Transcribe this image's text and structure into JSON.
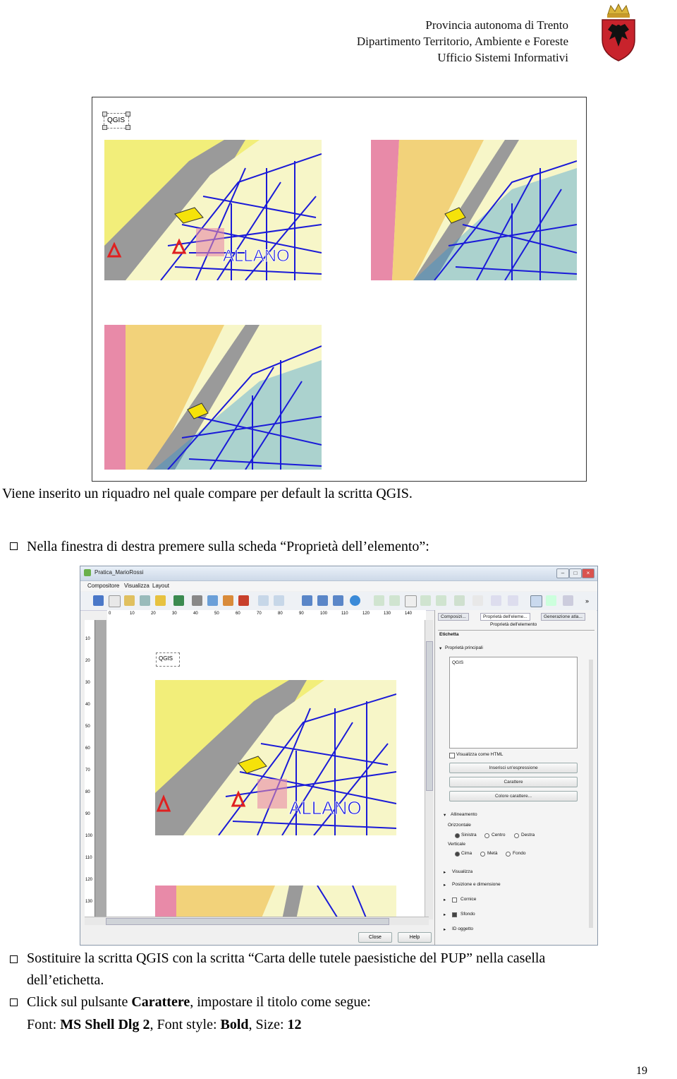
{
  "header": {
    "line1": "Provincia autonoma di Trento",
    "line2": "Dipartimento Territorio, Ambiente e Foreste",
    "line3": "Ufficio Sistemi Informativi"
  },
  "figure1": {
    "qgis_label": "QGIS",
    "map_label": "ALLANO"
  },
  "caption1": "Viene inserito un riquadro nel quale compare per default la scritta QGIS.",
  "bullet1": "Nella finestra di destra premere sulla scheda “Proprietà dell’elemento”:",
  "qgis_window": {
    "title": "Pratica_MarioRossi",
    "menus": [
      "Compositore",
      "Visualizza",
      "Layout"
    ],
    "ruler_top": [
      "0",
      "10",
      "20",
      "30",
      "40",
      "50",
      "60",
      "70",
      "80",
      "90",
      "100",
      "110",
      "120",
      "130",
      "140"
    ],
    "ruler_left": [
      "10",
      "20",
      "30",
      "40",
      "50",
      "60",
      "70",
      "80",
      "90",
      "100",
      "110",
      "120",
      "130"
    ],
    "canvas_label": "QGIS",
    "map_label": "ALLANO",
    "tabs": [
      "Composizi...",
      "Proprietà dell'eleme...",
      "Generazione atla..."
    ],
    "subtab": "Proprietà dell'elemento",
    "section_title": "Etichetta",
    "group_main": "Proprietà principali",
    "textbox_value": "QGIS",
    "html_checkbox": "Visualizza come HTML",
    "btn_expression": "Inserisci un'espressione",
    "btn_font": "Carattere",
    "btn_color": "Colore carattere...",
    "align_group": "Allineamento",
    "horizontal": "Orizzontale",
    "h_options": [
      "Sinistra",
      "Centro",
      "Destra"
    ],
    "vertical": "Verticale",
    "v_options": [
      "Cima",
      "Metà",
      "Fondo"
    ],
    "collapsed": [
      "Visualizza",
      "Posizione e dimensione",
      "Cornice",
      "Sfondo",
      "ID oggetto"
    ],
    "close_btn": "Close",
    "help_btn": "Help"
  },
  "bullet2": "Sostituire la scritta QGIS con la scritta “Carta delle tutele paesistiche del PUP” nella casella",
  "bullet2_cont": "dell’etichetta.",
  "bullet3_pre": "Click sul pulsante ",
  "bullet3_bold": "Carattere",
  "bullet3_post": ", impostare il titolo come segue:",
  "font_line": {
    "font_label": "Font: ",
    "font_value": "MS Shell Dlg 2",
    "style_label": ", Font style: ",
    "style_value": "Bold",
    "size_label": ", Size: ",
    "size_value": "12"
  },
  "page_number": "19",
  "colors": {
    "map_blue": "#1a1ad8",
    "map_yellow": "#f2ee7a",
    "map_pink": "#e88aa8",
    "map_river": "#1c8fd9"
  }
}
